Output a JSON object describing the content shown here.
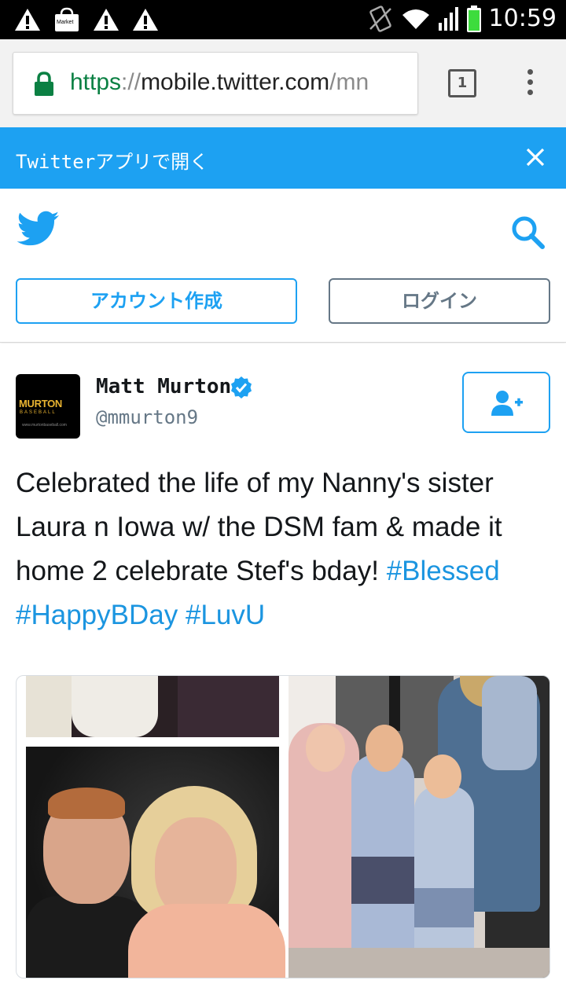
{
  "status_bar": {
    "time": "10:59",
    "market_label": "Market"
  },
  "browser": {
    "url_scheme": "https",
    "url_sep": "://",
    "url_host": "mobile.twitter.com",
    "url_path": "/mn",
    "tab_count": "1"
  },
  "app_banner": {
    "text": "Twitterアプリで開く"
  },
  "header": {
    "signup_label": "アカウント作成",
    "login_label": "ログイン"
  },
  "tweet": {
    "display_name": "Matt Murton",
    "handle": "@mmurton9",
    "avatar_logo": "MURTON",
    "avatar_sub": "BASEBALL",
    "avatar_url": "www.murtonbaseball.com",
    "text_main": "Celebrated the life of my Nanny's sister Laura n Iowa w/ the DSM fam & made it home 2 celebrate Stef's bday! ",
    "hashtags": [
      "#Blessed",
      "#HappyBDay",
      "#LuvU"
    ]
  },
  "colors": {
    "twitter_blue": "#1da1f2",
    "hashtag_blue": "#1b95e0",
    "secure_green": "#0b8043",
    "muted_gray": "#657786"
  }
}
